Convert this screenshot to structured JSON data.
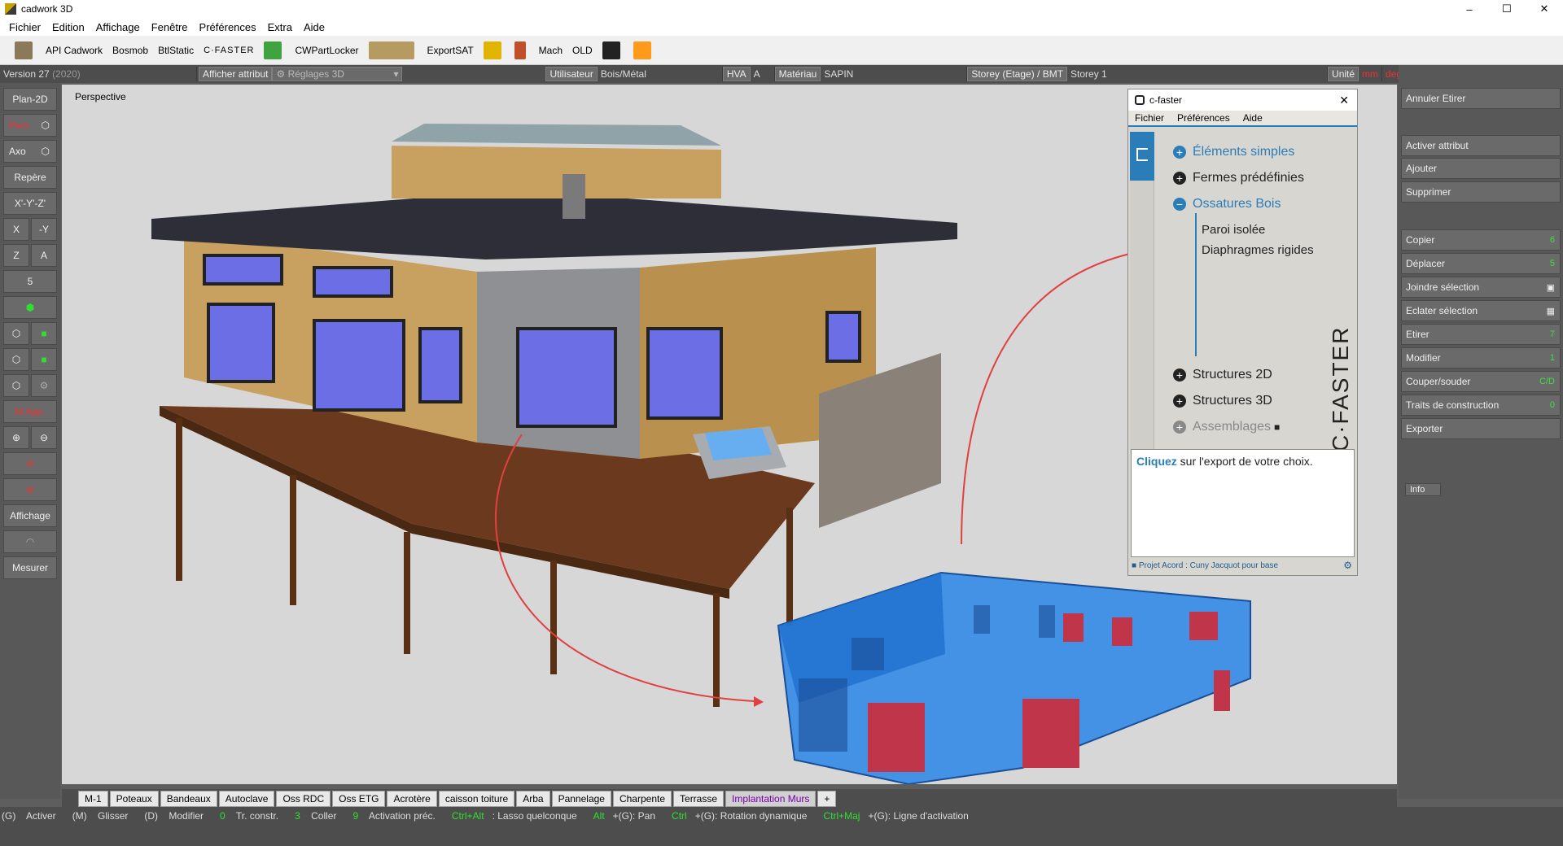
{
  "window": {
    "title": "cadwork 3D",
    "minimize": "–",
    "maximize": "☐",
    "close": "✕"
  },
  "menu": [
    "Fichier",
    "Edition",
    "Affichage",
    "Fenêtre",
    "Préférences",
    "Extra",
    "Aide"
  ],
  "plugins": [
    {
      "label": "",
      "icon": "book-icon",
      "color": "#8a7a5a"
    },
    {
      "label": "API Cadwork",
      "icon": "",
      "color": ""
    },
    {
      "label": "Bosmob",
      "icon": "",
      "color": ""
    },
    {
      "label": "BtlStatic",
      "icon": "",
      "color": ""
    },
    {
      "label": "C·FASTER",
      "icon": "",
      "color": ""
    },
    {
      "label": "",
      "icon": "export-green-icon",
      "color": "#3fa33f"
    },
    {
      "label": "CWPartLocker",
      "icon": "",
      "color": ""
    },
    {
      "label": "",
      "icon": "wood-texture-icon",
      "color": "#b59a62"
    },
    {
      "label": "ExportSAT",
      "icon": "",
      "color": ""
    },
    {
      "label": "",
      "icon": "csv-icon",
      "color": "#e0b400"
    },
    {
      "label": "",
      "icon": "figure-icon",
      "color": "#c0502a"
    },
    {
      "label": "Mach",
      "icon": "",
      "color": ""
    },
    {
      "label": "OLD",
      "icon": "",
      "color": ""
    },
    {
      "label": "",
      "icon": "cube-bw-icon",
      "color": "#222222"
    },
    {
      "label": "",
      "icon": "lock-orange-icon",
      "color": "#ff9a1a"
    }
  ],
  "status": {
    "version": "Version 27",
    "version_year": "(2020)",
    "show_attr": "Afficher attribut",
    "settings": "Réglages 3D",
    "user_label": "Utilisateur",
    "user_value": "Bois/Métal",
    "hva_label": "HVA",
    "hva_value": "A",
    "material_label": "Matériau",
    "material_value": "SAPIN",
    "storey_label": "Storey (Etage) / BMT",
    "storey_value": "Storey 1",
    "unit_label": "Unité",
    "unit_a": "mm",
    "unit_b": "deg"
  },
  "left": {
    "plan2d": "Plan-2D",
    "pers": "Pers",
    "axo": "Axo",
    "repere": "Repère",
    "xyz": "X'-Y'-Z'",
    "x": "X",
    "my": "-Y",
    "z": "Z",
    "a": "A",
    "five": "5",
    "multi": "M.App.",
    "affichage": "Affichage",
    "mesurer": "Mesurer"
  },
  "viewport": {
    "label": "Perspective"
  },
  "right": [
    {
      "label": "Annuler Etirer",
      "key": ""
    },
    {
      "label": "Activer attribut",
      "key": ""
    },
    {
      "label": "Ajouter",
      "key": ""
    },
    {
      "label": "Supprimer",
      "key": ""
    },
    {
      "label": "Copier",
      "key": "6"
    },
    {
      "label": "Déplacer",
      "key": "5"
    },
    {
      "label": "Joindre sélection",
      "key": ""
    },
    {
      "label": "Eclater sélection",
      "key": ""
    },
    {
      "label": "Etirer",
      "key": "7"
    },
    {
      "label": "Modifier",
      "key": "1"
    },
    {
      "label": "Couper/souder",
      "key": "C/D"
    },
    {
      "label": "Traits de construction",
      "key": "0"
    },
    {
      "label": "Exporter",
      "key": ""
    },
    {
      "label": "Info",
      "key": ""
    }
  ],
  "cfaster": {
    "title": "c-faster",
    "menu": [
      "Fichier",
      "Préférences",
      "Aide"
    ],
    "items": [
      {
        "label": "Éléments simples",
        "state": "plus",
        "color": "#2a7db7"
      },
      {
        "label": "Fermes prédéfinies",
        "state": "plus",
        "color": "#222222"
      },
      {
        "label": "Ossatures Bois",
        "state": "minus",
        "color": "#2a7db7"
      },
      {
        "label": "Structures 2D",
        "state": "plus",
        "color": "#222222"
      },
      {
        "label": "Structures 3D",
        "state": "plus",
        "color": "#222222"
      },
      {
        "label": "Assemblages",
        "state": "plus",
        "color": "#888888"
      }
    ],
    "sub": [
      "Paroi isolée",
      "Diaphragmes rigides"
    ],
    "brand": "C·FASTER",
    "hint_link": "Cliquez",
    "hint_rest": " sur l'export de votre choix.",
    "footer": "Projet Acord : Cuny Jacquot pour base",
    "lock_icon": "lock-icon"
  },
  "tabs": [
    "M-1",
    "Poteaux",
    "Bandeaux",
    "Autoclave",
    "Oss RDC",
    "Oss ETG",
    "Acrotère",
    "caisson toiture",
    "Arba",
    "Pannelage",
    "Charpente",
    "Terrasse",
    "Implantation Murs",
    "+"
  ],
  "hints": [
    {
      "k": "(G)",
      "t": " Activer"
    },
    {
      "k": "(M)",
      "t": " Glisser"
    },
    {
      "k": "(D)",
      "t": " Modifier"
    },
    {
      "k": "0",
      "t": " Tr. constr.",
      "g": true
    },
    {
      "k": "3",
      "t": " Coller",
      "g": true
    },
    {
      "k": "9",
      "t": " Activation préc.",
      "g": true
    },
    {
      "k": "Ctrl+Alt",
      "t": ": Lasso quelconque",
      "g": true
    },
    {
      "k": "Alt",
      "t": "+(G): Pan",
      "g": true
    },
    {
      "k": "Ctrl",
      "t": "+(G): Rotation dynamique",
      "g": true
    },
    {
      "k": "Ctrl+Maj",
      "t": "+(G): Ligne d'activation",
      "g": true
    }
  ]
}
